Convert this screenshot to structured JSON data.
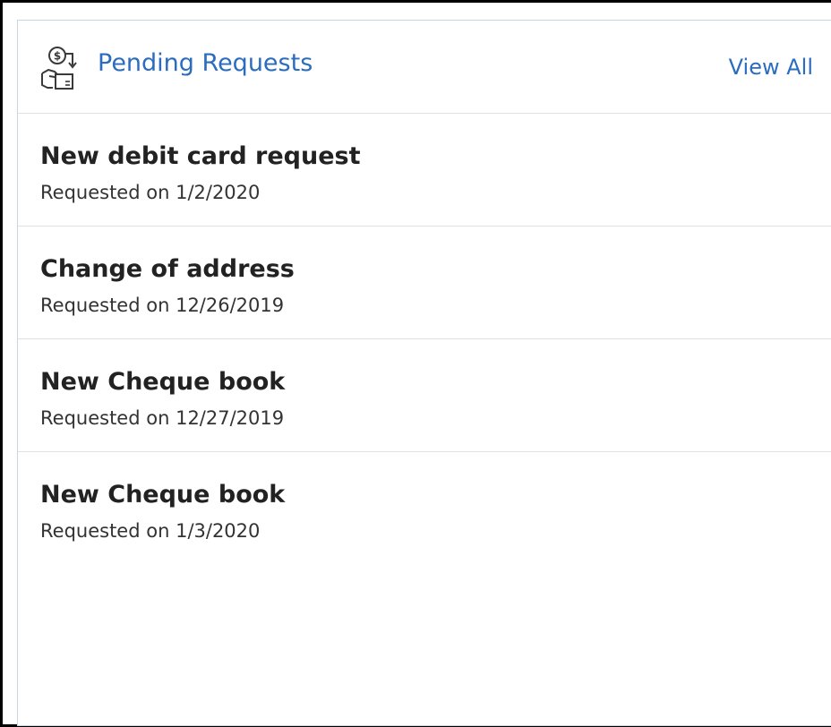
{
  "widget": {
    "title": "Pending Requests",
    "view_all_label": "View All",
    "icon": "money-request-icon",
    "accent_color": "#2b6cbf"
  },
  "requests": [
    {
      "title": "New debit card request",
      "prefix": "Requested on",
      "date": "1/2/2020"
    },
    {
      "title": "Change of address",
      "prefix": "Requested on",
      "date": "12/26/2019"
    },
    {
      "title": "New Cheque book",
      "prefix": "Requested on",
      "date": "12/27/2019"
    },
    {
      "title": "New Cheque book",
      "prefix": "Requested on",
      "date": "1/3/2020"
    }
  ]
}
